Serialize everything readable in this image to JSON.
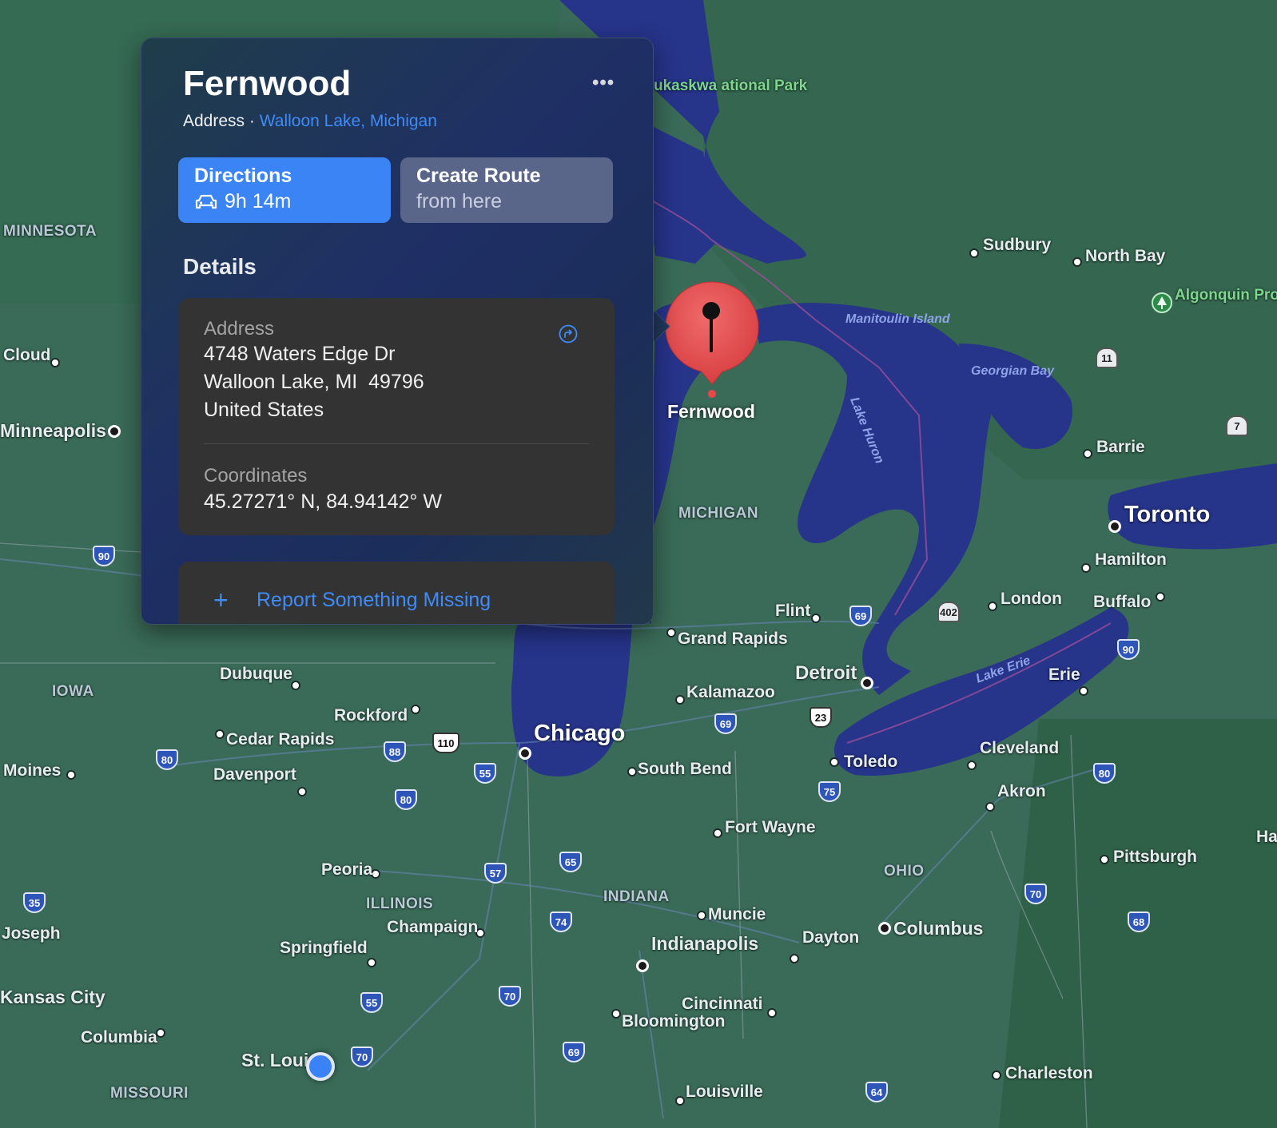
{
  "place": {
    "name": "Fernwood",
    "subtitle_kind": "Address",
    "subtitle_sep": "·",
    "subtitle_link": "Walloon Lake, Michigan",
    "more_label": "•••"
  },
  "actions": {
    "directions_label": "Directions",
    "directions_time": "9h 14m",
    "directions_icon": "car-icon",
    "route_label": "Create Route",
    "route_sub": "from here"
  },
  "details": {
    "heading": "Details",
    "address_label": "Address",
    "address_lines": [
      "4748 Waters Edge Dr",
      "Walloon Lake, MI  49796",
      "United States"
    ],
    "coordinates_label": "Coordinates",
    "coordinates_value": "45.27271° N, 84.94142° W"
  },
  "report": {
    "icon": "plus-icon",
    "label": "Report Something Missing"
  },
  "pin_label": "Fernwood",
  "colors": {
    "land": "#3a6a58",
    "water": "#26348a",
    "accent": "#3b84f6",
    "pin": "#e8484a",
    "card_bg": "#1f2f66",
    "panel_bg": "#333333"
  },
  "map": {
    "cities": [
      "Sudbury",
      "North Bay",
      "Cloud",
      "Minneapolis",
      "Barrie",
      "Toronto",
      "Hamilton",
      "Buffalo",
      "London",
      "Flint",
      "Grand Rapids",
      "Detroit",
      "Kalamazoo",
      "Dubuque",
      "Rockford",
      "Cedar Rapids",
      "Davenport",
      "Moines",
      "Chicago",
      "South Bend",
      "Toledo",
      "Cleveland",
      "Erie",
      "Akron",
      "Fort Wayne",
      "Peoria",
      "Champaign",
      "Springfield",
      "Muncie",
      "Indianapolis",
      "Dayton",
      "Columbus",
      "Pittsburgh",
      "Cincinnati",
      "Bloomington",
      "Joseph",
      "Kansas City",
      "Columbia",
      "St. Loui",
      "Louisville",
      "Charleston",
      "Ha"
    ],
    "states": [
      "MINNESOTA",
      "MICHIGAN",
      "IOWA",
      "ILLINOIS",
      "INDIANA",
      "OHIO",
      "MISSOURI"
    ],
    "water_labels": [
      "Manitoulin Island",
      "Georgian Bay",
      "Lake Huron",
      "Lake Erie"
    ],
    "parks": [
      "ukaskwa ational Park",
      "Algonquin Provincial"
    ],
    "highways": [
      "90",
      "69",
      "402",
      "90",
      "23",
      "69",
      "88",
      "110",
      "80",
      "55",
      "80",
      "75",
      "80",
      "35",
      "57",
      "65",
      "70",
      "74",
      "68",
      "55",
      "70",
      "70",
      "69",
      "64",
      "11",
      "7"
    ]
  }
}
